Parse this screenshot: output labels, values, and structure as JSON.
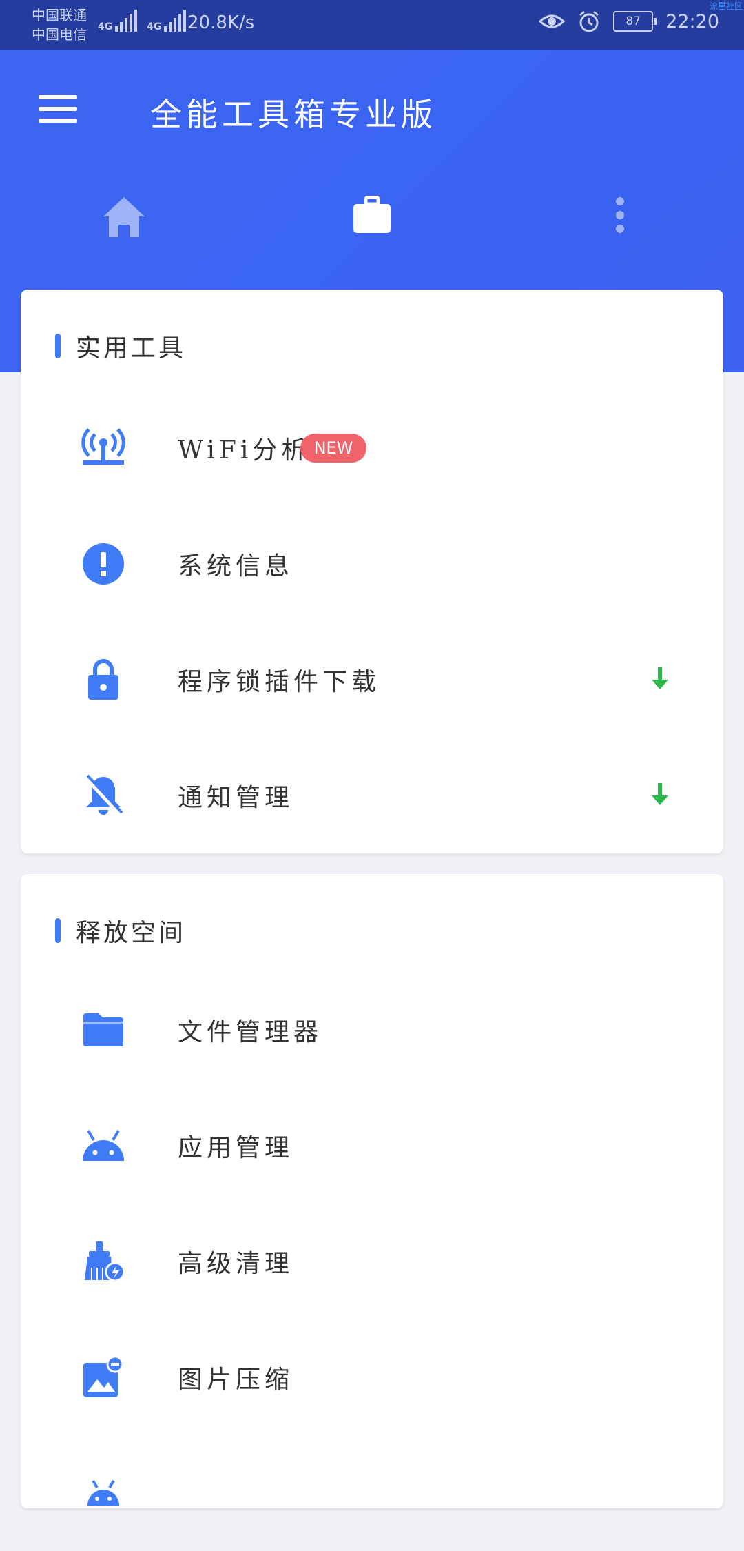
{
  "status_bar": {
    "carrier_1": "中国联通",
    "carrier_2": "中国电信",
    "net_1": "4G",
    "net_2": "4G",
    "speed": "20.8K/s",
    "battery": "87",
    "time": "22:20",
    "watermark": "流星社区"
  },
  "app_bar": {
    "title": "全能工具箱专业版",
    "tabs": [
      {
        "icon": "home-icon",
        "selected": false
      },
      {
        "icon": "briefcase-icon",
        "selected": true
      },
      {
        "icon": "more-vertical-icon",
        "selected": false
      }
    ]
  },
  "sections": [
    {
      "title": "实用工具",
      "items": [
        {
          "label": "WiFi分析",
          "icon": "wifi-analysis-icon",
          "badge": "NEW"
        },
        {
          "label": "系统信息",
          "icon": "info-alert-icon"
        },
        {
          "label": "程序锁插件下载",
          "icon": "lock-icon",
          "download": true
        },
        {
          "label": "通知管理",
          "icon": "bell-off-icon",
          "download": true
        }
      ]
    },
    {
      "title": "释放空间",
      "items": [
        {
          "label": "文件管理器",
          "icon": "folder-icon"
        },
        {
          "label": "应用管理",
          "icon": "android-icon"
        },
        {
          "label": "高级清理",
          "icon": "broom-icon"
        },
        {
          "label": "图片压缩",
          "icon": "image-compress-icon"
        },
        {
          "label": "",
          "icon": "android-icon"
        }
      ]
    }
  ],
  "colors": {
    "accent": "#3f7cf6",
    "app_bar": "#3a63f2",
    "status_bar": "#243d9e",
    "badge": "#f0636b",
    "download": "#2db84c"
  }
}
